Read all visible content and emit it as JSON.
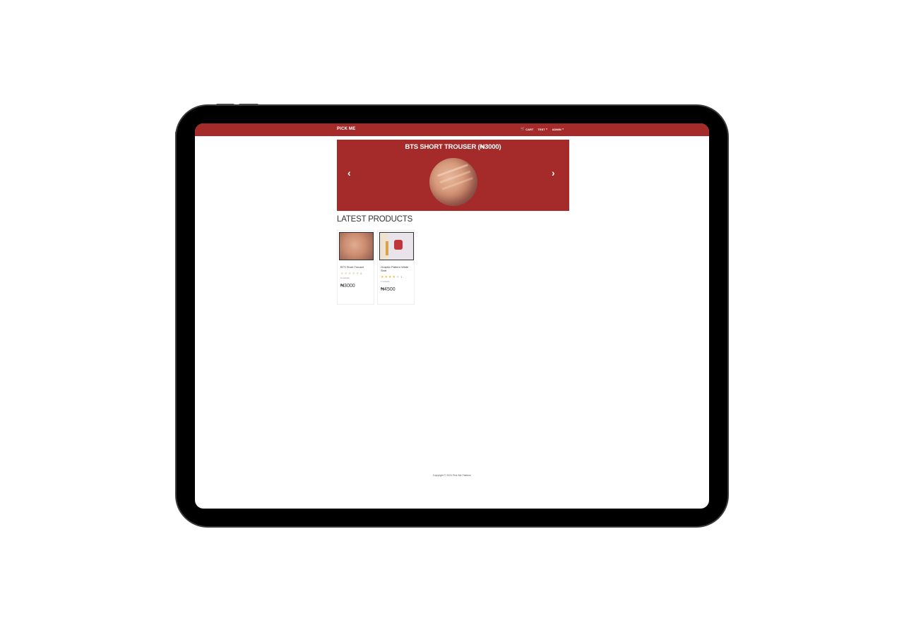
{
  "navbar": {
    "brand": "PICK ME",
    "cart_label": "CART",
    "test_label": "TEST",
    "admin_label": "ADMIN",
    "color": "#a52a2a"
  },
  "carousel": {
    "title": "BTS SHORT TROUSER (₦3000)",
    "prev_icon": "chevron-left-icon",
    "next_icon": "chevron-right-icon"
  },
  "latest": {
    "title": "LATEST PRODUCTS",
    "products": [
      {
        "name": "BTS Short Trouser",
        "rating": 0,
        "rating_count": "0",
        "reviews": "0 reviews",
        "price": "₦3000"
      },
      {
        "name": "Graphic Pattern White Shirt",
        "rating": 3.5,
        "rating_count": "1",
        "reviews": "1 reviews",
        "price": "₦4500"
      }
    ]
  },
  "footer": {
    "text": "Copyright © 2021 Pick Me Fashion"
  }
}
